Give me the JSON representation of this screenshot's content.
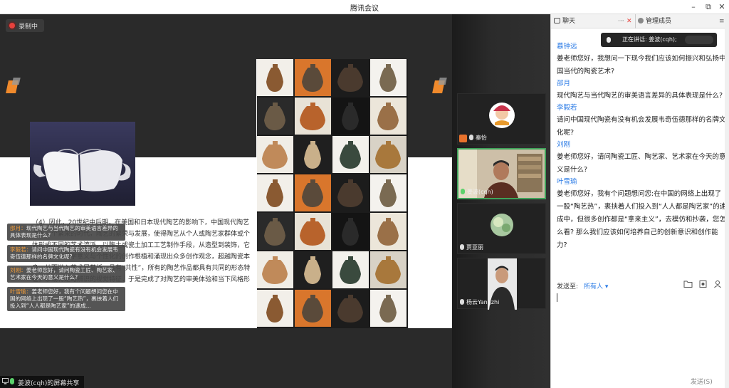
{
  "window": {
    "title": "腾讯会议",
    "minimize": "–",
    "restore": "⧉",
    "close": "✕"
  },
  "recording": {
    "label": "录制中"
  },
  "slide": {
    "paragraph": "（4）因此，20世纪中后期，在美国和日本现代陶艺的影响下，中国现代陶艺进入一个繁荣的时代，陶艺的繁荣与发展，使得陶艺从个人或陶艺家群体或个体形成不同的艺术流派，以陶土或瓷土加工工艺制作手段，从造型到装饰，它们把陶艺的美学意义与个性化的创作根植和涌现出众多创作观念，超越陶瓷本身，从而进入艺术展赏析，具有“共性”，所有的陶艺作品都具有共同的形态特征，享或特定可辨识的视觉特征，于是完成了对陶艺的审美体验和当下风格形式。"
  },
  "overlays": [
    {
      "name": "邵月：",
      "text": "现代陶艺与当代陶艺的审美语言差异的具体表现是什么?"
    },
    {
      "name": "李毅若：",
      "text": "请问中国现代陶瓷有没有机会发展韦奇伍德那样的名牌文化呢?"
    },
    {
      "name": "刘刚：",
      "text": "姜老师您好，请问陶瓷工匠、陶艺家、艺术家在今天的意义是什么?"
    },
    {
      "name": "叶雪瑜：",
      "text": "姜老师您好，我有个问题想问您在中国的网络上出现了一股“陶艺热”，裹挟着人们投入到“人人都是陶艺家”的速成..."
    }
  ],
  "screen_share": {
    "label": "姜波(cqh)的屏幕共享"
  },
  "participants": [
    {
      "name": "秦怡"
    },
    {
      "name": "姜波(cqh)"
    },
    {
      "name": "贾亚丽"
    },
    {
      "name": "杨云Yangzhi"
    }
  ],
  "chat": {
    "tabs": {
      "chat": "聊天",
      "more": "···",
      "close": "✕",
      "members": "管理成员",
      "menu": "≡"
    },
    "speaking": "正在讲话: 姜波(cqh);",
    "messages": [
      {
        "sender": "慕钟远",
        "text": "姜老师您好，我想问一下现今我们应该如何振兴和弘扬中国当代的陶瓷艺术?"
      },
      {
        "sender": "邵月",
        "text": "现代陶艺与当代陶艺的审美语言差异的具体表现是什么?"
      },
      {
        "sender": "李毅若",
        "text": "请问中国现代陶瓷有没有机会发展韦奇伍德那样的名牌文化呢?"
      },
      {
        "sender": "刘刚",
        "text": "姜老师您好，请问陶瓷工匠、陶艺家、艺术家在今天的意义是什么?"
      },
      {
        "sender": "叶雪瑜",
        "text": "姜老师您好，我有个问题想问您:在中国的网络上出现了一股“陶艺热”，裹挟着人们投入到“人人都是陶艺家”的速成中，但很多创作都是“拿来主义”，去模仿和抄袭，您怎么看? 那么我们应该如何培养自己的创新意识和创作能力?"
      }
    ],
    "send_to_label": "发送至:",
    "send_to_value": "所有人 ▾",
    "send_button": "发送(S)"
  },
  "colors": {
    "accent": "#2b7be6",
    "recording": "#e8413c",
    "overlay_name": "#f29d3a",
    "active_speaker": "#3fa35a"
  }
}
